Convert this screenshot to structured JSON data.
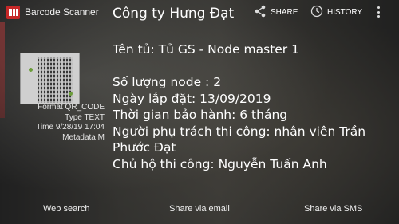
{
  "app": {
    "title": "Barcode Scanner"
  },
  "action_bar": {
    "share_label": "SHARE",
    "history_label": "HISTORY"
  },
  "result": {
    "heading": "Công ty Hưng Đạt",
    "lines": [
      "Tên tủ: Tủ GS - Node master 1",
      "",
      "Số lượng node : 2",
      "Ngày lắp đặt: 13/09/2019",
      "Thời gian bảo hành: 6 tháng",
      "Người phụ trách thi công: nhân viên Trần Phước Đạt",
      "Chủ hộ thi công: Nguyễn Tuấn Anh"
    ]
  },
  "meta": {
    "format_label": "Format",
    "format_value": "QR_CODE",
    "type_label": "Type",
    "type_value": "TEXT",
    "time_label": "Time",
    "time_value": "9/28/19 17:04",
    "metadata_label": "Metadata",
    "metadata_value": "M"
  },
  "bottom_buttons": {
    "web_search": "Web search",
    "share_email": "Share via email",
    "share_sms": "Share via SMS"
  },
  "icons": {
    "app": "barcode-app-icon",
    "share": "share-icon",
    "history": "history-clock-icon",
    "overflow": "overflow-menu-icon"
  },
  "colors": {
    "app_icon": "#c62828"
  }
}
